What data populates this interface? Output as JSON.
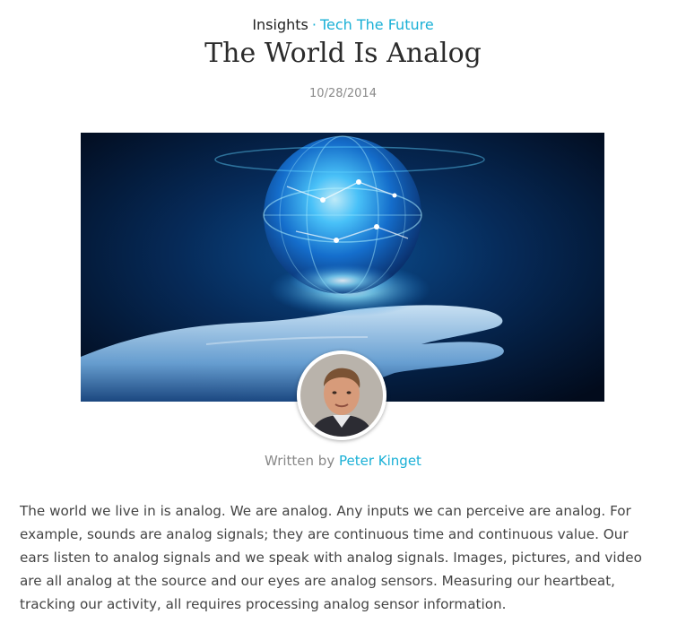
{
  "breadcrumb": {
    "parent": "Insights",
    "separator": "·",
    "category": "Tech The Future"
  },
  "article": {
    "title": "The World Is Analog",
    "date": "10/28/2014",
    "hero_image": "glowing-globe-over-hand-image",
    "byline_prefix": "Written by",
    "author": "Peter Kinget",
    "body": "The world we live in is analog. We are analog. Any inputs we can perceive are analog. For example, sounds are analog signals; they are continuous time and continuous value. Our ears listen to analog signals and we speak with analog signals. Images, pictures, and video are all analog at the source and our eyes are analog sensors. Measuring our heartbeat, tracking our activity, all requires processing analog sensor information."
  },
  "colors": {
    "accent": "#1ab0d6",
    "title": "#2b2b2b",
    "muted": "#888888",
    "body_text": "#444444"
  }
}
